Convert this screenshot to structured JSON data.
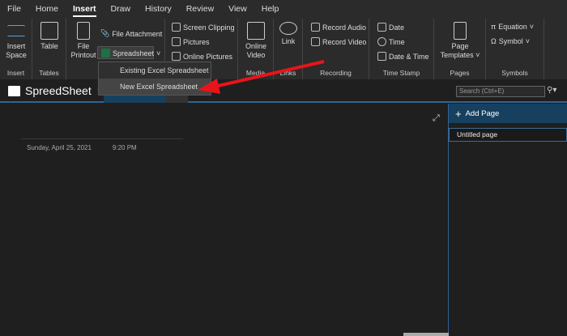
{
  "tabs": [
    "File",
    "Home",
    "Insert",
    "Draw",
    "History",
    "Review",
    "View",
    "Help"
  ],
  "active_tab": "Insert",
  "ribbon": {
    "insert_space": "Insert Space",
    "insert_group": "Insert",
    "table": "Table",
    "tables_group": "Tables",
    "file_printout": "File Printout",
    "file_attachment": "File Attachment",
    "spreadsheet": "Spreadsheet",
    "screen_clipping": "Screen Clipping",
    "pictures": "Pictures",
    "online_pictures": "Online Pictures",
    "online_video": "Online Video",
    "media_group": "Media",
    "link": "Link",
    "links_group": "Links",
    "record_audio": "Record Audio",
    "record_video": "Record Video",
    "recording_group": "Recording",
    "date": "Date",
    "time": "Time",
    "date_time": "Date & Time",
    "timestamp_group": "Time Stamp",
    "page_templates": "Page Templates",
    "pages_group": "Pages",
    "equation": "Equation",
    "symbol": "Symbol",
    "symbols_group": "Symbols"
  },
  "dropdown": {
    "items": [
      "Existing Excel Spreadsheet",
      "New Excel Spreadsheet"
    ]
  },
  "notebook": {
    "name": "SpreedSheet"
  },
  "search": {
    "placeholder": "Search (Ctrl+E)"
  },
  "page": {
    "date": "Sunday, April 25, 2021",
    "time": "9:20 PM"
  },
  "pages_pane": {
    "add_page": "Add Page",
    "pages": [
      "Untitled page"
    ]
  },
  "colors": {
    "accent": "#2f6494",
    "arrow": "#e8141b"
  }
}
